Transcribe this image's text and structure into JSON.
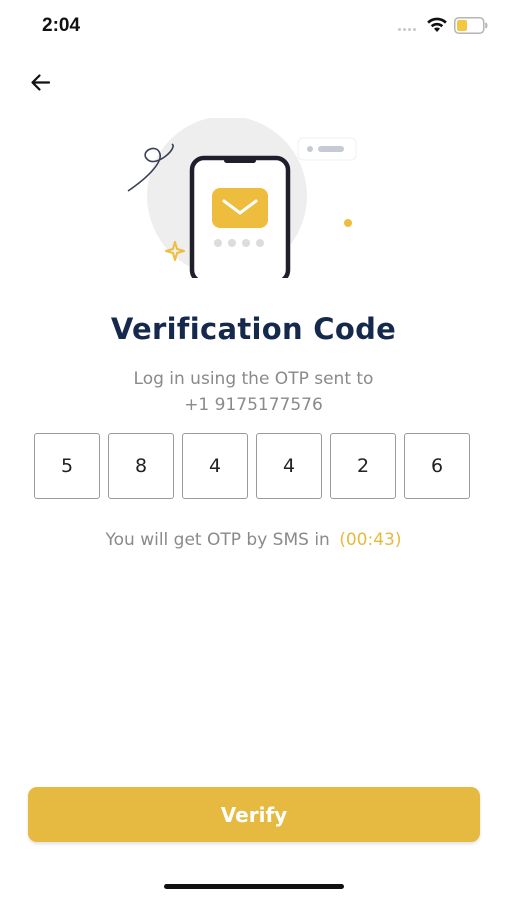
{
  "status_bar": {
    "time": "2:04",
    "battery_color": "#f2c744"
  },
  "header": {
    "back_icon": "arrow-left-icon"
  },
  "illustration": {
    "icon": "phone-envelope-icon",
    "accent_color": "#efbd3e"
  },
  "content": {
    "title": "Verification Code",
    "subtitle_line1": "Log in using the OTP sent to",
    "subtitle_line2": "+1 9175177576"
  },
  "otp": {
    "digits": [
      "5",
      "8",
      "4",
      "4",
      "2",
      "6"
    ]
  },
  "resend": {
    "text": "You will get OTP by SMS in",
    "timer": "(00:43)",
    "timer_color": "#e6ba3e"
  },
  "footer": {
    "verify_label": "Verify",
    "button_color": "#e6b941"
  }
}
